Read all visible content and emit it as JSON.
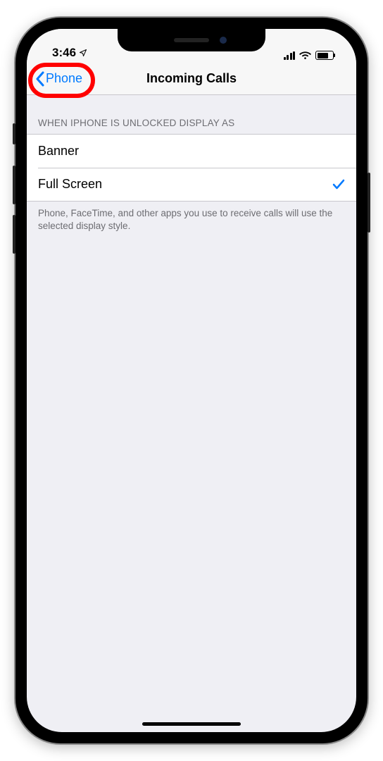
{
  "status_bar": {
    "time": "3:46"
  },
  "nav": {
    "back_label": "Phone",
    "title": "Incoming Calls"
  },
  "section": {
    "header": "WHEN IPHONE IS UNLOCKED DISPLAY AS",
    "footer": "Phone, FaceTime, and other apps you use to receive calls will use the selected display style."
  },
  "options": [
    {
      "label": "Banner",
      "selected": false
    },
    {
      "label": "Full Screen",
      "selected": true
    }
  ]
}
